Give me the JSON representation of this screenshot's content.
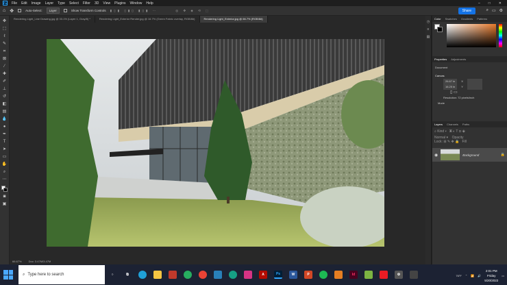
{
  "app": {
    "name": "Ps",
    "menu": [
      "File",
      "Edit",
      "Image",
      "Layer",
      "Type",
      "Select",
      "Filter",
      "3D",
      "View",
      "Plugins",
      "Window",
      "Help"
    ]
  },
  "options": {
    "auto_select": "Auto-Select:",
    "layer": "Layer",
    "show_transform": "Show Transform Controls",
    "share": "Share"
  },
  "tabs": [
    {
      "label": "Rendering Light_Line Drawing.jpg @ 33.1% (Layer 1, Gray/8) *",
      "active": false
    },
    {
      "label": "Rendering Light_Exterior Render.jpg @ 16.7% (Green Fabric overlay, RGB/8#)",
      "active": false
    },
    {
      "label": "Rendering Light_Exterior.jpg @ 66.7% (RGB/8#)",
      "active": true
    }
  ],
  "status": {
    "zoom": "66.67%",
    "doc": "Doc: 3.47M/3.47M"
  },
  "panels": {
    "color_tabs": [
      "Color",
      "Swatches",
      "Gradients",
      "Patterns"
    ],
    "properties_tabs": [
      "Properties",
      "Adjustments"
    ],
    "document_label": "Document",
    "canvas_label": "Canvas",
    "width": "26.67 in",
    "height": "16.25 in",
    "x_label": "X",
    "y_label": "Y",
    "resolution": "Resolution: 72 pixels/inch",
    "mode": "Mode",
    "layers_tabs": [
      "Layers",
      "Channels",
      "Paths"
    ],
    "layer_name": "Background"
  },
  "taskbar": {
    "search_placeholder": "Type here to search",
    "time": "2:01 PM",
    "day": "Friday",
    "date": "5/20/2022",
    "weather": "76°F"
  }
}
